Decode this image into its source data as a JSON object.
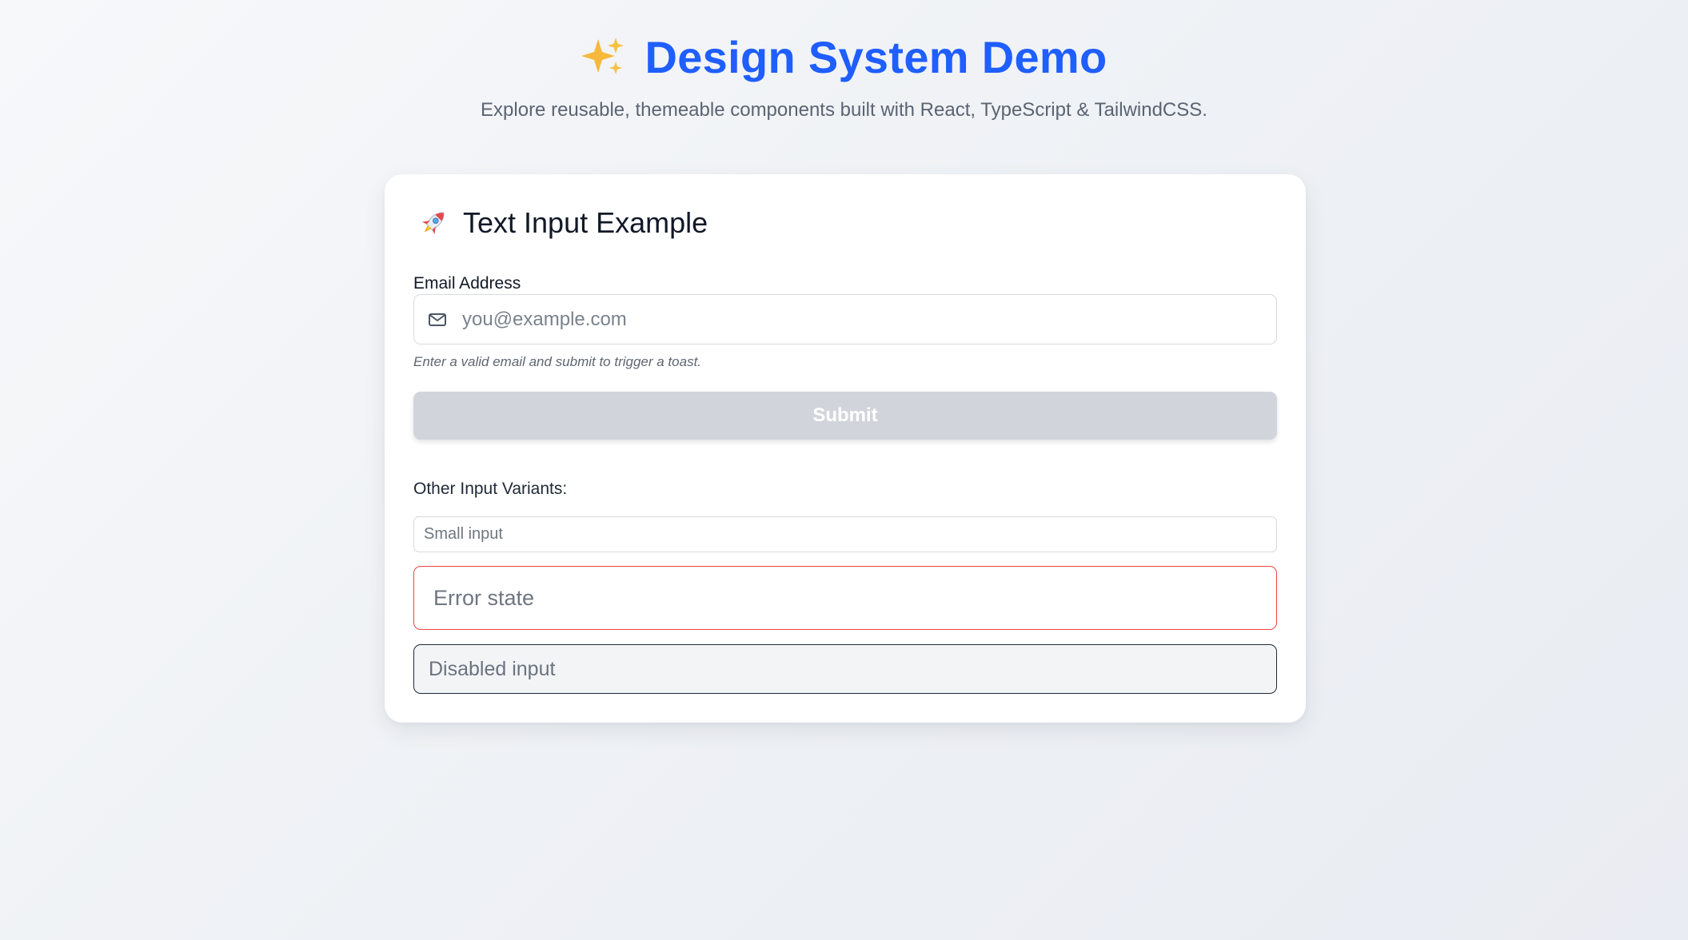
{
  "header": {
    "sparkle_icon": "sparkles-icon",
    "title": "Design System Demo",
    "subtitle": "Explore reusable, themeable components built with React, TypeScript & TailwindCSS."
  },
  "card": {
    "icon": "rocket-icon",
    "title": "Text Input Example",
    "email": {
      "label": "Email Address",
      "icon": "mail-icon",
      "placeholder": "you@example.com",
      "value": "",
      "helper": "Enter a valid email and submit to trigger a toast."
    },
    "submit": {
      "label": "Submit",
      "disabled": true
    },
    "variants": {
      "label": "Other Input Variants:",
      "small_placeholder": "Small input",
      "error_placeholder": "Error state",
      "disabled_placeholder": "Disabled input"
    }
  },
  "colors": {
    "title_blue": "#1f5eff",
    "error_red": "#ef4444",
    "disabled_button_gray": "#d1d5db",
    "border_gray": "#d6d9de"
  }
}
